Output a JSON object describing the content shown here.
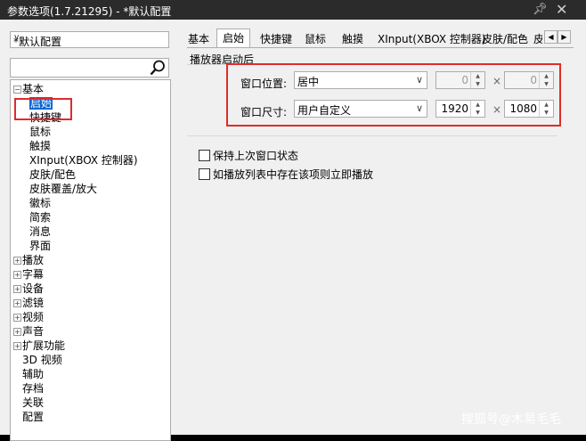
{
  "window": {
    "title": "参数选项(1.7.21295) - *默认配置"
  },
  "profile": {
    "selected": "*默认配置"
  },
  "tree": {
    "basic_group": "基本",
    "basic_children": [
      "启始",
      "快捷键",
      "鼠标",
      "触摸",
      "XInput(XBOX 控制器)",
      "皮肤/配色",
      "皮肤覆盖/放大",
      "徽标",
      "简索",
      "消息",
      "界面"
    ],
    "groups": [
      "播放",
      "字幕",
      "设备",
      "滤镜",
      "视频",
      "声音",
      "扩展功能"
    ],
    "leaves": [
      "3D 视频",
      "辅助",
      "存档",
      "关联",
      "配置"
    ]
  },
  "tabs": [
    "基本",
    "启始",
    "快捷键",
    "鼠标",
    "触摸",
    "XInput(XBOX 控制器)",
    "皮肤/配色",
    "皮"
  ],
  "startup": {
    "group_title": "播放器启动后",
    "position_label": "窗口位置:",
    "position_value": "居中",
    "position_x": "0",
    "position_y": "0",
    "size_label": "窗口尺寸:",
    "size_value": "用户自定义",
    "size_w": "1920",
    "size_h": "1080",
    "times": "×"
  },
  "options": {
    "keep_state": "保持上次窗口状态",
    "play_if_in_list": "如播放列表中存在该项则立即播放"
  },
  "watermark": "搜狐号@木易毛毛",
  "colors": {
    "highlight": "#e02b2b",
    "selection": "#0a64d6"
  }
}
